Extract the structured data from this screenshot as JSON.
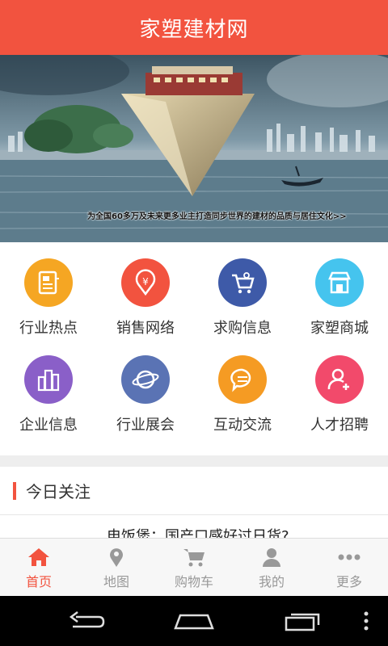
{
  "header": {
    "title": "家塑建材网"
  },
  "banner": {
    "caption": "为全国60多万及未来更多业主打造同步世界的建材的品质与居住文化>>"
  },
  "grid": {
    "items": [
      {
        "label": "行业热点",
        "icon": "news-icon",
        "color": "#f5a623"
      },
      {
        "label": "销售网络",
        "icon": "yen-pin-icon",
        "color": "#f2533f"
      },
      {
        "label": "求购信息",
        "icon": "cart-icon",
        "color": "#3e5aa8"
      },
      {
        "label": "家塑商城",
        "icon": "store-icon",
        "color": "#45c4ee"
      },
      {
        "label": "企业信息",
        "icon": "buildings-icon",
        "color": "#8a5fc8"
      },
      {
        "label": "行业展会",
        "icon": "globe-icon",
        "color": "#5a73b4"
      },
      {
        "label": "互动交流",
        "icon": "chat-icon",
        "color": "#f59b23"
      },
      {
        "label": "人才招聘",
        "icon": "add-user-icon",
        "color": "#f24a6b"
      }
    ]
  },
  "section": {
    "title": "今日关注"
  },
  "news": {
    "headline": "电饭煲：国产口感好过日货?"
  },
  "tabs": {
    "items": [
      {
        "label": "首页",
        "icon": "home-icon"
      },
      {
        "label": "地图",
        "icon": "map-pin-icon"
      },
      {
        "label": "购物车",
        "icon": "cart-icon"
      },
      {
        "label": "我的",
        "icon": "person-icon"
      },
      {
        "label": "更多",
        "icon": "more-icon"
      }
    ],
    "active": 0
  },
  "colors": {
    "accent": "#f2533f",
    "tab_inactive": "#999999",
    "divider": "#eeeeee"
  }
}
